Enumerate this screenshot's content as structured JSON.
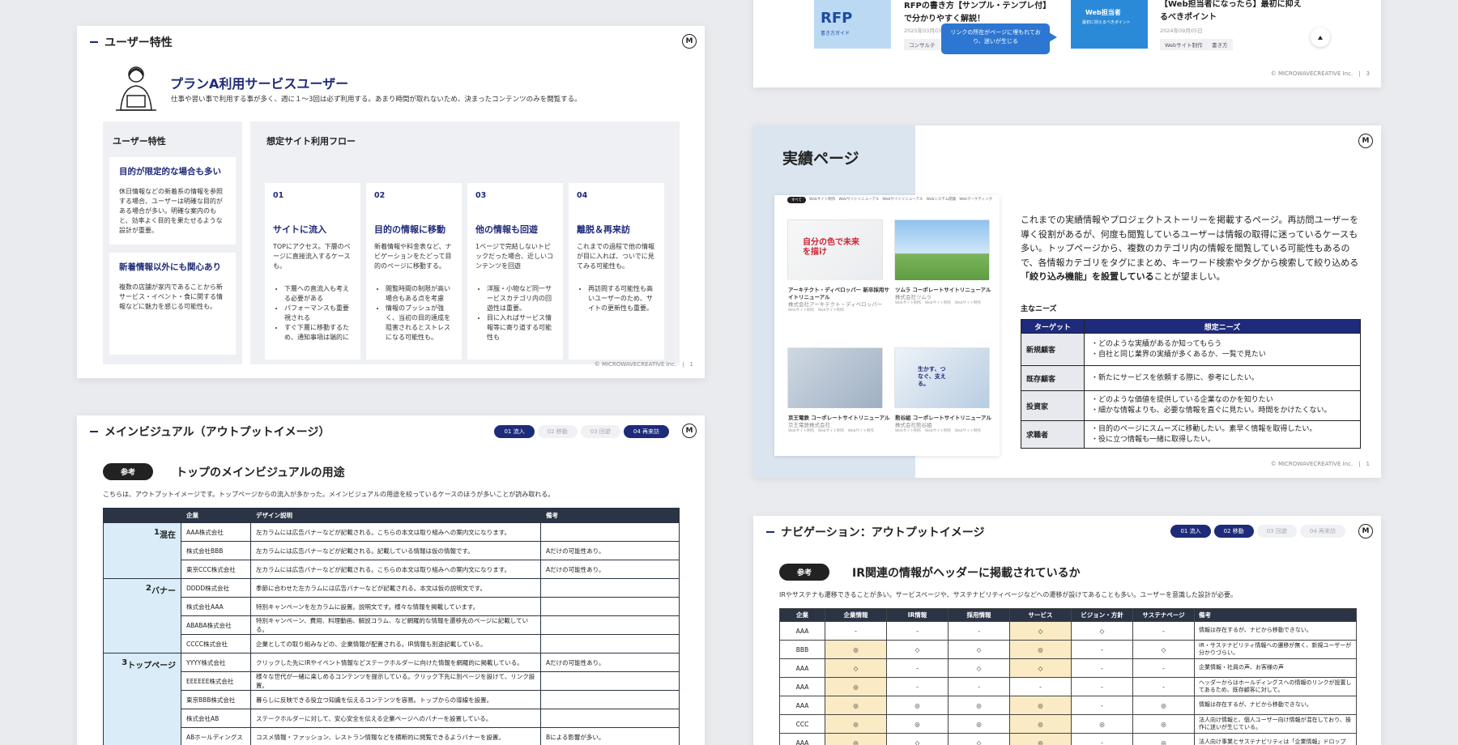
{
  "brand": {
    "logo_letter": "M",
    "footer_text": "© MICROWAVECREATIVE Inc."
  },
  "slide1": {
    "title": "ユーザー特性",
    "persona_name": "プランA利用サービスユーザー",
    "persona_desc": "仕事や習い事で利用する事が多く、週に１〜3回は必ず利用する。あまり時間が取れないため、決まったコンテンツのみを閲覧する。",
    "traits_heading": "ユーザー特性",
    "traits": [
      {
        "title": "目的が限定的な場合も多い",
        "text": "休日情報などの新着系の情報を参照する場合、ユーザーは明確な目的がある場合が多い。明確な案内のもと、効率よく目的を果たせるような設計が重要。"
      },
      {
        "title": "新着情報以外にも関心あり",
        "text": "複数の店舗が家内であることから新サービス・イベント・食に関する情報などに魅力を感じる可能性も。"
      }
    ],
    "flow_heading": "想定サイト利用フロー",
    "flow": [
      {
        "num": "01",
        "title": "サイトに流入",
        "text": "TOPにアクセス。下層のページに直接流入するケースも。",
        "bullets": [
          "下層への直流入も考える必要がある",
          "パフォーマンスも重要視される",
          "すぐ下層に移動するため、通知事項は端的に"
        ]
      },
      {
        "num": "02",
        "title": "目的の情報に移動",
        "text": "新着情報や料金表など、ナビゲーションをたどって目的のページに移動する。",
        "bullets": [
          "閲覧時間の制限が高い場合もある点を考慮",
          "情報のプッシュが強く、当初の目的達成を阻害されるとストレスになる可能性も。"
        ]
      },
      {
        "num": "03",
        "title": "他の情報も回遊",
        "text": "1ページで完結しないトピックだった場合、近しいコンテンツを回遊",
        "bullets": [
          "洋服・小物など同一サービスカテゴリ内の回遊性は重要。",
          "目に入ればサービス情報等に寄り道する可能性も"
        ]
      },
      {
        "num": "04",
        "title": "離脱＆再来訪",
        "text": "これまでの過程で他の情報が目に入れば、ついでに見てみる可能性も。",
        "bullets": [
          "再訪問する可能性も高いユーザーのため、サイトの更新性も重要。"
        ]
      }
    ],
    "page": "1"
  },
  "slide2": {
    "article1_title": "RFPの書き方【サンプル・テンプレ付】で分かりやすく解説！",
    "article1_thumb": "RFP",
    "article1_thumb_sub": "書き方ガイド",
    "article1_date": "2025年03月03日",
    "article1_tag": "コンサルテ",
    "callout": "リンクの所在がページに埋もれており、迷いが生じる",
    "article2_thumb": "Web担当者",
    "article2_thumb_sub": "最初に抑えるべきポイント",
    "article2_title": "【Web担当者になったら】最初に抑えるべきポイント",
    "article2_date": "2024年09月05日",
    "article2_tags": [
      "Webサイト制作",
      "書き方"
    ],
    "page": "3"
  },
  "slide3": {
    "title": "メインビジュアル（アウトプットイメージ）",
    "steps": [
      {
        "label": "01 流入",
        "on": true
      },
      {
        "label": "02 移動",
        "on": false
      },
      {
        "label": "03 回遊",
        "on": false
      },
      {
        "label": "04 再来訪",
        "on": true
      }
    ],
    "tag": "参考",
    "heading": "トップのメインビジュアルの用途",
    "desc": "こちらは、アウトプットイメージです。トップページからの流入が多かった。メインビジュアルの用途を絞っているケースのほうが多いことが読み取れる。",
    "headers": [
      "",
      "企業",
      "デザイン説明",
      "備考"
    ],
    "groups": [
      {
        "name": "混在",
        "num": "1",
        "rows": [
          [
            "AAA株式会社",
            "左カラムには広告バナーなどが記載される。こちらの本文は取り組みへの案内文になります。",
            ""
          ],
          [
            "株式会社BBB",
            "左カラムには広告バナーなどが記載される。記載している情報は仮の情報です。",
            "Aだけの可能性あり。"
          ],
          [
            "東京CCC株式会社",
            "左カラムには広告バナーなどが記載される。こちらの本文は取り組みへの案内文になります。",
            "Aだけの可能性あり。"
          ]
        ]
      },
      {
        "name": "バナー",
        "num": "2",
        "rows": [
          [
            "DDDD株式会社",
            "季節に合わせた左カラムには広告バナーなどが記載される。本文は仮の説明文です。",
            ""
          ],
          [
            "株式会社AAA",
            "特別キャンペーンを左カラムに設置。説明文です。様々な情報を掲載しています。",
            ""
          ],
          [
            "ABABA株式会社",
            "特別キャンペーン、費用、料理動画、解説コラム、など網羅的な情報を遷移先のページに記載している。",
            ""
          ],
          [
            "CCCC株式会社",
            "企業としての取り組みなどの、企業情報が配置される。IR情報も別途記載している。",
            ""
          ]
        ]
      },
      {
        "name": "トップページ",
        "num": "3",
        "rows": [
          [
            "YYYY株式会社",
            "クリックした先にIRやイベント情報などステークホルダーに向けた情報を網羅的に掲載している。",
            "Aだけの可能性あり。"
          ],
          [
            "EEEEEE株式会社",
            "様々な世代が一緒に楽しめるコンテンツを提示している。クリック下先に別ページを設けて、リンク設置。",
            ""
          ],
          [
            "東京BBB株式会社",
            "暮らしに反映できる役立つ知識を伝えるコンテンツを容易。トップからの導線を設置。",
            ""
          ],
          [
            "株式会社AB",
            "ステークホルダーに対して、安心安全を伝える企業ページへのバナーを設置している。",
            ""
          ],
          [
            "ABホールディングス",
            "コスメ情報・ファッション、レストラン情報などを横断的に閲覧できるようバナーを設置。",
            "Bによる影響が多い。"
          ]
        ]
      }
    ]
  },
  "slide4": {
    "title": "実績ページ",
    "nav": [
      "すべて",
      "Webサイト制作",
      "Webサイトリニューアル",
      "Webサイトリニューアル",
      "Webシステム開発",
      "Webマーケティング"
    ],
    "thumbs": [
      {
        "img_text": "自分の色で未来を描け",
        "title": "アーキテクト・ディベロッパー 新卒採用サイトリニューアル",
        "company": "株式会社アーキテクト・ディベロッパー",
        "tags": [
          "Webサイト制作",
          "Webサイト制作"
        ]
      },
      {
        "img_text": "",
        "title": "ツムラ コーポレートサイトリニューアル",
        "company": "株式会社ツムラ",
        "tags": [
          "Webサイト制作",
          "Webサイト制作",
          "Webサイト制作"
        ]
      },
      {
        "img_text": "",
        "title": "京王電鉄 コーポレートサイトリニューアル",
        "company": "京王電鉄株式会社",
        "tags": [
          "Webサイト制作",
          "Webサイト制作",
          "Webサイト制作"
        ]
      },
      {
        "img_text": "生かす、つなぐ、支える。",
        "title": "熊谷組 コーポレートサイトリニューアル",
        "company": "株式会社熊谷組",
        "tags": [
          "Webサイト制作",
          "Webサイト制作",
          "Webサイト制作"
        ]
      }
    ],
    "body_plain": "これまでの実績情報やプロジェクトストーリーを掲載するページ。再訪問ユーザーを導く役割があるが、何度も閲覧しているユーザーは情報の取得に迷っているケースも多い。トップページから、複数のカテゴリ内の情報を閲覧している可能性もあるので、各情報カテゴリをタグにまとめ、キーワード検索やタグから検索して絞り込める",
    "body_bold": "「絞り込み機能」を設置している",
    "body_end": "ことが望ましい。",
    "needs_heading": "主なニーズ",
    "table_headers": [
      "ターゲット",
      "想定ニーズ"
    ],
    "rows": [
      {
        "target": "新規顧客",
        "needs": [
          "・どのような実績があるか知ってもらう",
          "・自社と同じ業界の実績が多くあるか、一覧で見たい"
        ]
      },
      {
        "target": "既存顧客",
        "needs": [
          "・新たにサービスを依頼する際に、参考にしたい。"
        ]
      },
      {
        "target": "投資家",
        "needs": [
          "・どのような価値を提供している企業なのかを知りたい",
          "・細かな情報よりも、必要な情報を直ぐに見たい。時間をかけたくない。"
        ]
      },
      {
        "target": "求職者",
        "needs": [
          "・目的のページにスムーズに移動したい。素早く情報を取得したい。",
          "・役に立つ情報も一緒に取得したい。"
        ]
      }
    ],
    "page": "1"
  },
  "slide5": {
    "title": "ナビゲーション：アウトプットイメージ",
    "steps": [
      {
        "label": "01 流入",
        "on": true
      },
      {
        "label": "02 移動",
        "on": true
      },
      {
        "label": "03 回遊",
        "on": false
      },
      {
        "label": "04 再来訪",
        "on": false
      }
    ],
    "tag": "参考",
    "heading": "IR関連の情報がヘッダーに掲載されているか",
    "desc": "IRやサステナも遷移できることが多い。サービスページや、サステナビリティページなどへの遷移が設けてあることも多い。ユーザーを意識した設計が必要。",
    "headers": [
      "企業",
      "企業情報",
      "IR情報",
      "採用情報",
      "サービス",
      "ビジョン・方針",
      "サステナページ",
      "備考"
    ],
    "rows": [
      {
        "cells": [
          "AAA",
          "-",
          "-",
          "-",
          "◇",
          "◇",
          "-"
        ],
        "hi": [
          4
        ],
        "note": "情報は存在するが、ナビから移動できない。"
      },
      {
        "cells": [
          "BBB",
          "◎",
          "◇",
          "◇",
          "◎",
          "-",
          "◇"
        ],
        "hi": [
          1,
          4
        ],
        "note": "IR・サステナビリティ情報への遷移が無く、新規ユーザーが分かりづらい。"
      },
      {
        "cells": [
          "AAA",
          "◇",
          "-",
          "◇",
          "◇",
          "-",
          "-"
        ],
        "hi": [
          1,
          4
        ],
        "note": "企業情報・社員の声、お客様の声"
      },
      {
        "cells": [
          "AAA",
          "◎",
          "-",
          "-",
          "-",
          "-",
          "-"
        ],
        "hi": [
          1
        ],
        "note": "ヘッダーからはホールディングスへの情報のリンクが設置してあるため、既存顧客に対して。"
      },
      {
        "cells": [
          "AAA",
          "◎",
          "◎",
          "◎",
          "◎",
          "-",
          "◎"
        ],
        "hi": [
          1,
          4
        ],
        "note": "情報は存在するが、ナビから移動できない。"
      },
      {
        "cells": [
          "CCC",
          "◎",
          "◎",
          "◎",
          "◎",
          "◎",
          "◎"
        ],
        "hi": [
          1,
          4
        ],
        "note": "法人向け情報と、個人ユーザー向け情報が混在しており、操作に迷いが生じている。"
      },
      {
        "cells": [
          "AAA",
          "◎",
          "◇",
          "◇",
          "◎",
          "-",
          "◎"
        ],
        "hi": [
          1,
          4
        ],
        "note": "法人向け事業とサステナビリティは「企業情報」ドロップ"
      }
    ]
  }
}
